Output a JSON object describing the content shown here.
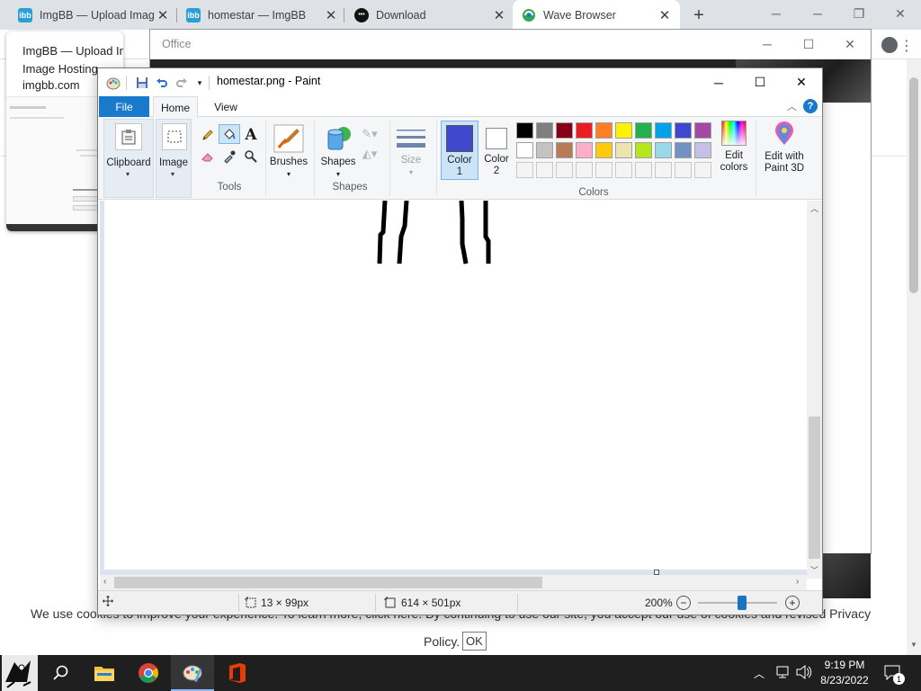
{
  "browser": {
    "tabs": [
      {
        "title": "ImgBB — Upload Imag",
        "favicon": "imgbb-icon",
        "active": false
      },
      {
        "title": "homestar — ImgBB",
        "favicon": "imgbb-icon",
        "active": false
      },
      {
        "title": "Download",
        "favicon": "dots-icon",
        "active": false
      },
      {
        "title": "Wave Browser",
        "favicon": "wave-icon",
        "active": true
      }
    ],
    "new_tab": "+"
  },
  "hover_card": {
    "title_line1": "ImgBB — Upload Image",
    "title_line2": "Image Hosting",
    "url": "imgbb.com"
  },
  "office": {
    "title": "Office"
  },
  "cookie_banner": {
    "text_line1": "We use cookies to improve your experience. To learn more, click   here. By continuing to use our site, you accept our use of cookies and revised   Privacy",
    "text_line2": "Policy.",
    "ok_label": "OK"
  },
  "paint": {
    "window_title": "homestar.png - Paint",
    "tabs": {
      "file": "File",
      "home": "Home",
      "view": "View"
    },
    "groups": {
      "clipboard": "Clipboard",
      "image": "Image",
      "tools": "Tools",
      "brushes": "Brushes",
      "shapes_btn": "Shapes",
      "shapes": "Shapes",
      "size": "Size",
      "color1_l1": "Color",
      "color1_l2": "1",
      "color2_l1": "Color",
      "color2_l2": "2",
      "colors": "Colors",
      "edit_colors_l1": "Edit",
      "edit_colors_l2": "colors",
      "paint3d_l1": "Edit with",
      "paint3d_l2": "Paint 3D"
    },
    "color1": "#3f48cc",
    "color2": "#ffffff",
    "palette_row1": [
      "#000000",
      "#7f7f7f",
      "#880015",
      "#ed1c24",
      "#ff7f27",
      "#fff200",
      "#22b14c",
      "#00a2e8",
      "#3f48cc",
      "#a349a4"
    ],
    "palette_row2": [
      "#ffffff",
      "#c3c3c3",
      "#b97a57",
      "#ffaec9",
      "#ffc90e",
      "#efe4b0",
      "#b5e61d",
      "#99d9ea",
      "#7092be",
      "#c8bfe7"
    ],
    "status": {
      "selection": "13 × 99px",
      "image_size": "614 × 501px",
      "zoom": "200%"
    }
  },
  "taskbar": {
    "time": "9:19 PM",
    "date": "8/23/2022",
    "notification_count": "1"
  }
}
